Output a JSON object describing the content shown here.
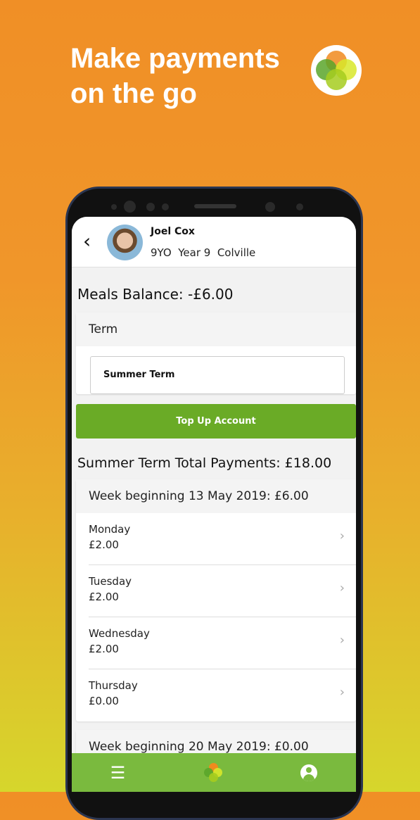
{
  "promo": {
    "headline": "Make payments on the go"
  },
  "header": {
    "name": "Joel Cox",
    "details": "9YO  Year 9  Colville"
  },
  "balance": "Meals Balance: -£6.00",
  "term": {
    "label": "Term",
    "selected": "Summer Term"
  },
  "topup_label": "Top Up Account",
  "total": "Summer Term Total Payments: £18.00",
  "weeks": [
    {
      "title": "Week beginning 13 May 2019: £6.00",
      "days": [
        {
          "day": "Monday",
          "amount": "£2.00"
        },
        {
          "day": "Tuesday",
          "amount": "£2.00"
        },
        {
          "day": "Wednesday",
          "amount": "£2.00"
        },
        {
          "day": "Thursday",
          "amount": "£0.00"
        }
      ]
    },
    {
      "title": "Week beginning 20 May 2019: £0.00"
    }
  ],
  "nav": [
    "menu-icon",
    "home-logo-icon",
    "profile-icon"
  ],
  "colors": {
    "accent": "#6aab26",
    "nav": "#7aba3e"
  }
}
